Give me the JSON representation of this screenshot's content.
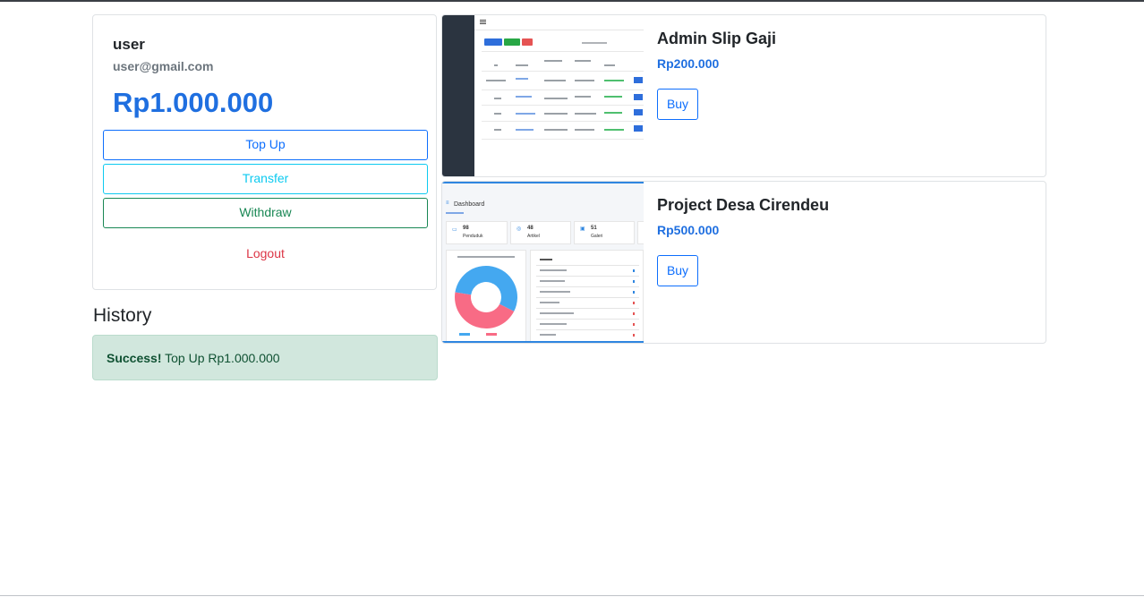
{
  "wallet": {
    "user_name": "user",
    "email": "user@gmail.com",
    "balance": "Rp1.000.000",
    "topup_label": "Top Up",
    "transfer_label": "Transfer",
    "withdraw_label": "Withdraw",
    "logout_label": "Logout"
  },
  "history": {
    "title": "History",
    "items": [
      {
        "status": "Success!",
        "message": "Top Up Rp1.000.000"
      }
    ]
  },
  "products": [
    {
      "title": "Admin Slip Gaji",
      "price": "Rp200.000",
      "buy_label": "Buy"
    },
    {
      "title": "Project Desa Cirendeu",
      "price": "Rp500.000",
      "buy_label": "Buy"
    }
  ],
  "thumbnails": {
    "dashboard": {
      "title": "Dashboard",
      "stats": [
        {
          "value": "98",
          "label": "Penduduk"
        },
        {
          "value": "48",
          "label": "Artikel"
        },
        {
          "value": "51",
          "label": "Galeri"
        }
      ]
    }
  },
  "colors": {
    "primary": "#0d6efd",
    "info": "#0dcaf0",
    "success": "#198754",
    "danger": "#dc3545",
    "alert_bg": "#d1e7dd",
    "balance": "#1f6fe0"
  },
  "chart_data": {
    "type": "pie",
    "categories": [
      "Laki-laki",
      "Perempuan"
    ],
    "values": [
      55,
      45
    ],
    "colors": [
      "#44a8f0",
      "#f86b85"
    ]
  }
}
